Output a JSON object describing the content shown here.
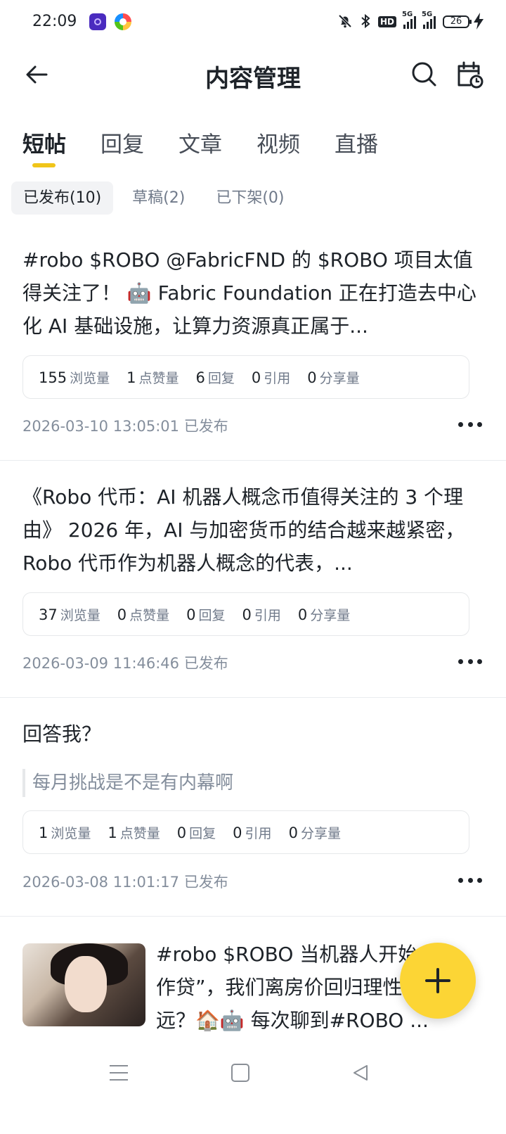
{
  "status_bar": {
    "time": "22:09",
    "icons": [
      "app-icon-purple",
      "app-icon-colorful",
      "bell-muted-icon",
      "bluetooth-icon",
      "hd-icon",
      "signal-5g-icon",
      "signal-5g-icon",
      "battery-icon",
      "charging-icon"
    ],
    "hd_label": "HD",
    "net1": "5G",
    "net2": "5G",
    "battery": "26"
  },
  "header": {
    "title": "内容管理",
    "back_icon": "arrow-left-icon",
    "search_icon": "search-icon",
    "calendar_icon": "calendar-clock-icon"
  },
  "tabs": [
    {
      "label": "短帖",
      "active": true
    },
    {
      "label": "回复",
      "active": false
    },
    {
      "label": "文章",
      "active": false
    },
    {
      "label": "视频",
      "active": false
    },
    {
      "label": "直播",
      "active": false
    }
  ],
  "filters": [
    {
      "label": "已发布(10)",
      "active": true
    },
    {
      "label": "草稿(2)",
      "active": false
    },
    {
      "label": "已下架(0)",
      "active": false
    }
  ],
  "stat_labels": {
    "views": "浏览量",
    "likes": "点赞量",
    "replies": "回复",
    "quotes": "引用",
    "shares": "分享量"
  },
  "posts": [
    {
      "text": "#robo $ROBO @FabricFND 的 $ROBO 项目太值得关注了！ 🤖 Fabric Foundation 正在打造去中心化 AI 基础设施，让算力资源真正属于...",
      "stats": {
        "views": "155",
        "likes": "1",
        "replies": "6",
        "quotes": "0",
        "shares": "0"
      },
      "meta": "2026-03-10 13:05:01 已发布"
    },
    {
      "text": "《Robo 代币：AI 机器人概念币值得关注的 3 个理由》 2026 年，AI 与加密货币的结合越来越紧密，Robo 代币作为机器人概念的代表，...",
      "stats": {
        "views": "37",
        "likes": "0",
        "replies": "0",
        "quotes": "0",
        "shares": "0"
      },
      "meta": "2026-03-09 11:46:46 已发布"
    },
    {
      "text": "回答我？",
      "quote": "每月挑战是不是有内幕啊",
      "stats": {
        "views": "1",
        "likes": "1",
        "replies": "0",
        "quotes": "0",
        "shares": "0"
      },
      "meta": "2026-03-08 11:01:17 已发布"
    },
    {
      "text": "#robo $ROBO 当机器人开始“工作贷”，我们离房价回归理性还有多远？🏠🤖 每次聊到#ROBO ..."
    }
  ],
  "fab": {
    "icon": "plus-icon"
  },
  "navbar": {
    "menu_icon": "menu-icon",
    "home_icon": "square-icon",
    "back_icon": "triangle-back-icon"
  }
}
